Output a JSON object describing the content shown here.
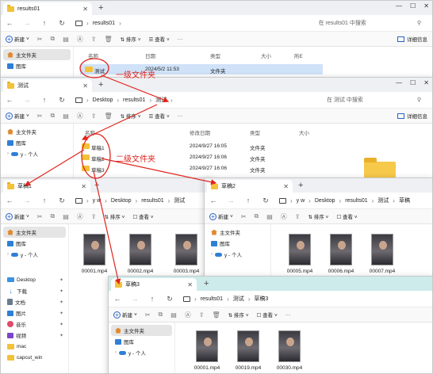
{
  "annotations": {
    "level1_label": "一级文件夹",
    "level2_label": "二级文件夹",
    "color": "#e0231c"
  },
  "window1": {
    "tab_title": "results01",
    "crumb": "results01",
    "search_placeholder": "在 results01 中搜索",
    "toolbar": {
      "new": "新建",
      "sort": "排序",
      "view": "查看",
      "more": "···",
      "details": "详细信息"
    },
    "columns": {
      "name": "名称",
      "date": "日期",
      "type": "类型",
      "size": "大小",
      "tag": "所E"
    },
    "nav": [
      {
        "label": "主文件夹",
        "icon": "home-icon"
      },
      {
        "label": "图库",
        "icon": "gallery-icon"
      }
    ],
    "files": [
      {
        "name": "测试",
        "date": "2024/5/2 11:53",
        "type": "文件夹"
      }
    ]
  },
  "window2": {
    "tab_title": "测试",
    "crumbs": [
      "Desktop",
      "results01",
      "测试"
    ],
    "search_placeholder": "在 测试 中搜索",
    "toolbar": {
      "new": "新建",
      "sort": "排序",
      "view": "查看",
      "more": "···",
      "details": "详细信息"
    },
    "columns": {
      "name": "名称",
      "date": "修改日期",
      "type": "类型",
      "size": "大小"
    },
    "nav": [
      {
        "label": "主文件夹"
      },
      {
        "label": "图库"
      },
      {
        "label": "y - 个人"
      }
    ],
    "files": [
      {
        "name": "草稿1",
        "date": "2024/9/27 16:05",
        "type": "文件夹"
      },
      {
        "name": "草稿2",
        "date": "2024/9/27 16:06",
        "type": "文件夹"
      },
      {
        "name": "草稿3",
        "date": "2024/9/27 16:06",
        "type": "文件夹"
      }
    ]
  },
  "window3": {
    "tab_title": "草稿1",
    "crumbs": [
      "y w",
      "Desktop",
      "results01",
      "测试"
    ],
    "toolbar": {
      "new": "新建",
      "sort": "排序",
      "view": "查看"
    },
    "nav": [
      {
        "label": "主文件夹"
      },
      {
        "label": "图库"
      },
      {
        "label": "y - 个人"
      },
      {
        "label": "Desktop"
      },
      {
        "label": "下载"
      },
      {
        "label": "文档"
      },
      {
        "label": "图片"
      },
      {
        "label": "音乐"
      },
      {
        "label": "视频"
      },
      {
        "label": "mac"
      },
      {
        "label": "capcut_win"
      }
    ],
    "files": [
      "00001.mp4",
      "00002.mp4",
      "00003.mp4"
    ]
  },
  "window4": {
    "tab_title": "草稿2",
    "crumbs": [
      "y w",
      "Desktop",
      "results01",
      "测试",
      "草稿"
    ],
    "toolbar": {
      "new": "新建",
      "sort": "排序",
      "view": "查看"
    },
    "nav": [
      {
        "label": "主文件夹"
      },
      {
        "label": "图库"
      },
      {
        "label": "y - 个人"
      }
    ],
    "files": [
      "00005.mp4",
      "00006.mp4",
      "00007.mp4"
    ]
  },
  "window5": {
    "tab_title": "草稿3",
    "crumbs": [
      "results01",
      "测试",
      "草稿3"
    ],
    "toolbar": {
      "new": "新建",
      "sort": "排序",
      "view": "查看",
      "more": "···"
    },
    "nav": [
      {
        "label": "主文件夹"
      },
      {
        "label": "图库"
      },
      {
        "label": "y - 个人"
      }
    ],
    "files": [
      "00001.mp4",
      "00019.mp4",
      "00030.mp4"
    ]
  }
}
